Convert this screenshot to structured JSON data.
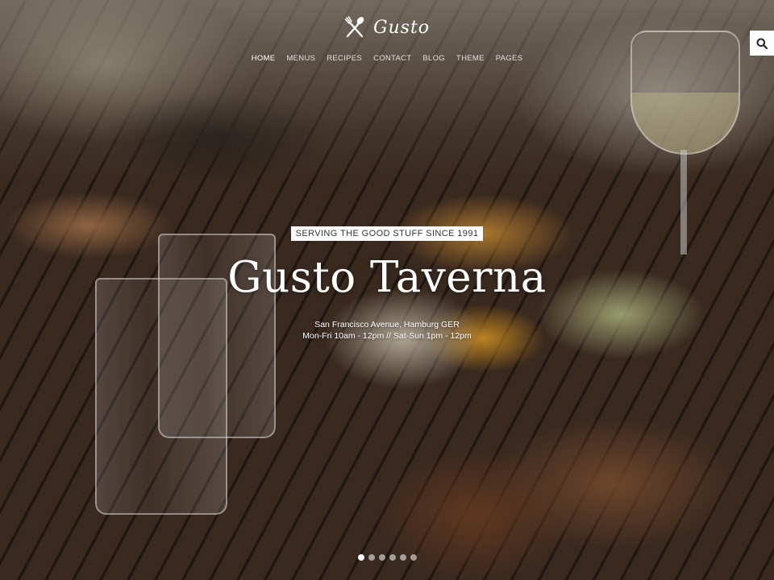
{
  "header": {
    "logo_text": "Gusto",
    "logo_icon": "fork-knife-icon",
    "nav": [
      {
        "label": "HOME",
        "active": true
      },
      {
        "label": "MENUS",
        "active": false
      },
      {
        "label": "RECIPES",
        "active": false
      },
      {
        "label": "CONTACT",
        "active": false
      },
      {
        "label": "BLOG",
        "active": false
      },
      {
        "label": "THEME",
        "active": false
      },
      {
        "label": "PAGES",
        "active": false
      }
    ],
    "search_icon": "search-icon"
  },
  "hero": {
    "tagline": "SERVING THE GOOD STUFF SINCE 1991",
    "title": "Gusto Taverna",
    "address": "San Francisco Avenue, Hamburg GER",
    "hours": "Mon-Fri 10am - 12pm // Sat-Sun 1pm - 12pm"
  },
  "slider": {
    "total": 6,
    "active_index": 0
  },
  "colors": {
    "text": "#ffffff",
    "tagline_bg": "#ffffff",
    "tagline_text": "#333333"
  }
}
